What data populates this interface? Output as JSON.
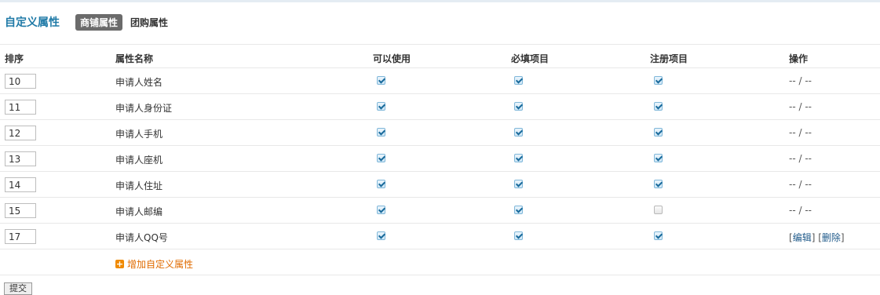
{
  "header": {
    "title": "自定义属性",
    "tabs": [
      {
        "label": "商铺属性",
        "active": true
      },
      {
        "label": "团购属性",
        "active": false
      }
    ]
  },
  "table": {
    "columns": [
      "排序",
      "属性名称",
      "可以使用",
      "必填项目",
      "注册项目",
      "操作"
    ],
    "rows": [
      {
        "order": "10",
        "name": "申请人姓名",
        "usable": true,
        "required": true,
        "register": true,
        "op": "-- / --"
      },
      {
        "order": "11",
        "name": "申请人身份证",
        "usable": true,
        "required": true,
        "register": true,
        "op": "-- / --"
      },
      {
        "order": "12",
        "name": "申请人手机",
        "usable": true,
        "required": true,
        "register": true,
        "op": "-- / --"
      },
      {
        "order": "13",
        "name": "申请人座机",
        "usable": true,
        "required": true,
        "register": true,
        "op": "-- / --"
      },
      {
        "order": "14",
        "name": "申请人住址",
        "usable": true,
        "required": true,
        "register": true,
        "op": "-- / --"
      },
      {
        "order": "15",
        "name": "申请人邮编",
        "usable": true,
        "required": true,
        "register": false,
        "op": "-- / --"
      },
      {
        "order": "17",
        "name": "申请人QQ号",
        "usable": true,
        "required": true,
        "register": true,
        "edit_label": "编辑",
        "delete_label": "删除"
      }
    ]
  },
  "add_label": "增加自定义属性",
  "submit_label": "提交",
  "colors": {
    "title": "#1f7aa7",
    "active_tab_bg": "#6b6b6b",
    "add_link": "#e06b00",
    "link": "#1f5a8a"
  }
}
